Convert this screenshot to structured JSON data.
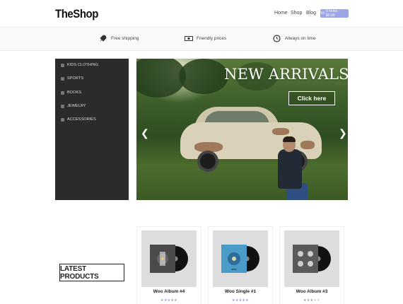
{
  "header": {
    "logo": "TheShop",
    "nav": [
      "Home",
      "Shop",
      "Blog"
    ],
    "cart_label": "0 items - $0.00"
  },
  "features": [
    {
      "label": "Free shipping",
      "icon": "rocket-icon"
    },
    {
      "label": "Friendly prices",
      "icon": "money-icon"
    },
    {
      "label": "Always on time",
      "icon": "clock-icon"
    }
  ],
  "sidebar": {
    "items": [
      {
        "label": "KIDS CLOTHING",
        "icon": "shirt-icon"
      },
      {
        "label": "SPORTS",
        "icon": "cap-icon"
      },
      {
        "label": "BOOKS",
        "icon": "book-icon"
      },
      {
        "label": "JEWELRY",
        "icon": "diamond-icon"
      },
      {
        "label": "ACCESSORIES",
        "icon": "bag-icon"
      }
    ]
  },
  "slider": {
    "title": "NEW ARRIVALS",
    "button": "Click here"
  },
  "section": {
    "latest_title": "LATEST PRODUCTS"
  },
  "products": [
    {
      "name": "Woo Album #4",
      "stars": 5,
      "sleeve_color": "#4a4a4a"
    },
    {
      "name": "Woo Single #1",
      "stars": 5,
      "sleeve_color": "#4b9bc8"
    },
    {
      "name": "Woo Album #3",
      "stars": 3,
      "sleeve_color": "#5a5a5a"
    }
  ],
  "colors": {
    "accent": "#9aa6e6",
    "sidebar_bg": "#2b2b2b"
  }
}
